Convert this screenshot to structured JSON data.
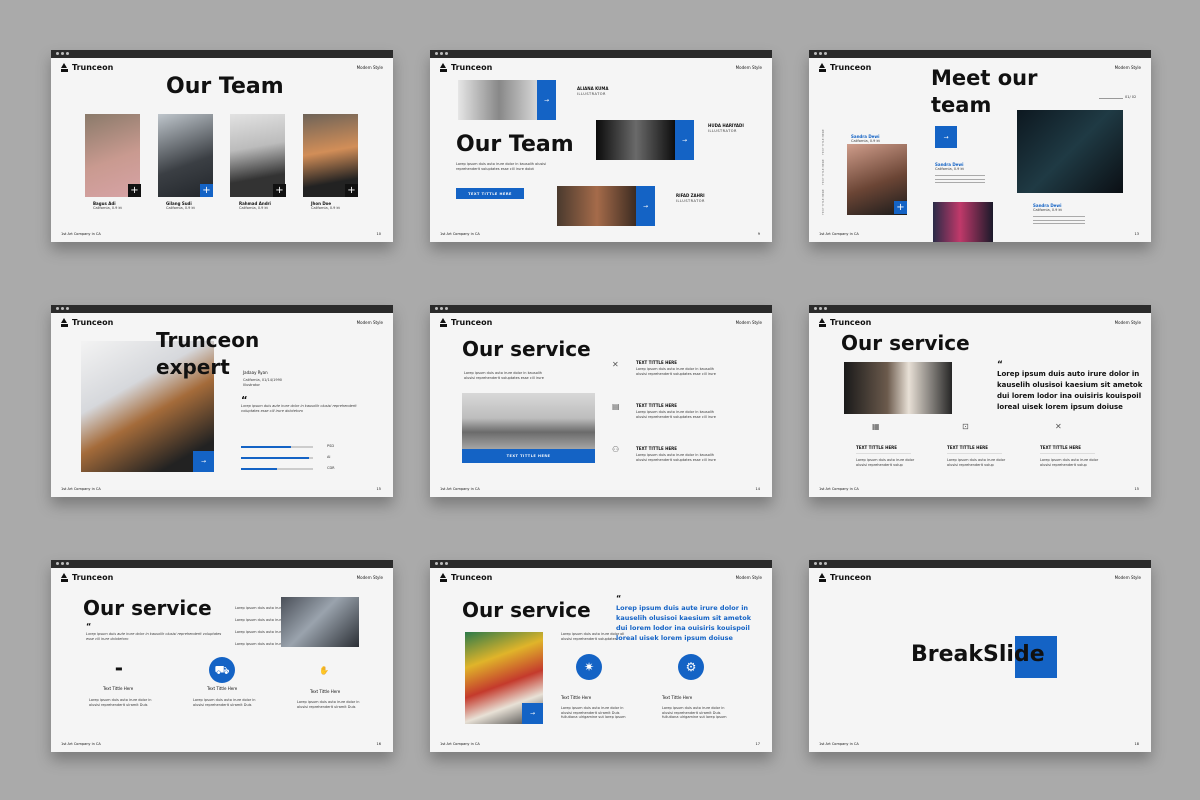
{
  "common": {
    "brand": "Trunceon",
    "tag": "Modern Style",
    "footer": "1st Art Company in CA"
  },
  "slides": {
    "s1": {
      "title": "Our Team",
      "page": "10",
      "members": [
        {
          "name": "Bagus Adi",
          "loc": "California, 0.9 kt"
        },
        {
          "name": "Gilang Sudi",
          "loc": "California, 0.9 kt"
        },
        {
          "name": "Rahmad Andri",
          "loc": "California, 0.9 kt"
        },
        {
          "name": "Jhon Doe",
          "loc": "California, 0.9 kt"
        }
      ]
    },
    "s2": {
      "title": "Our Team",
      "page": "9",
      "button": "TEXT TITTLE HERE",
      "people": [
        {
          "name": "ALIANA KUMA",
          "role": "ILLUSTRATOR"
        },
        {
          "name": "HUDA HARIYADI",
          "role": "ILLUSTRATOR"
        },
        {
          "name": "RIFAD ZAHRI",
          "role": "ILLUSTRATOR"
        }
      ]
    },
    "s3": {
      "title_line1": "Meet our",
      "title_line2": "team",
      "counter": "01/ 02",
      "page": "13",
      "people": [
        {
          "name": "Sandra Dewi",
          "loc": "California, 0.9 kt"
        },
        {
          "name": "Sandra Dewi",
          "loc": "California, 0.9 kt"
        },
        {
          "name": "Sandra Dewi",
          "loc": "California, 0.9 kt"
        }
      ],
      "side_labels": [
        "TEXT TITLE HERE",
        "TEXT TITLE HERE",
        "TEXT TITLE HERE"
      ]
    },
    "s4": {
      "title_line1": "Trunceon",
      "title_line2": "expert",
      "person": "Jadaay Ryan",
      "person_loc": "California, 01/14/1990",
      "person_role": "Illustrator",
      "quote": "Lorep ipsum duis aute irure dolor in kausolih olusisi reprehenderit voluptates esse cill irure dolotetoro",
      "skills": [
        {
          "label": "PSD",
          "value": 0.7
        },
        {
          "label": "AI",
          "value": 0.95
        },
        {
          "label": "CDR",
          "value": 0.5
        }
      ],
      "page": "15"
    },
    "s5": {
      "title": "Our service",
      "button": "TEXT TITTLE HERE",
      "items": [
        "TEXT TITTLE HERE",
        "TEXT TITTLE HERE",
        "TEXT TITTLE HERE"
      ],
      "page": "14"
    },
    "s6": {
      "title": "Our service",
      "quote_mark": "“",
      "quote": [
        "Lorep ipsum duis auto irure dolor in",
        "kauselih olusisoi kaesium sit ametok",
        "dui lorem lodor ina ouisiris kouispoil",
        "loreal uisek lorem ipsum doiuse"
      ],
      "items": [
        "TEXT TITTLE HERE",
        "TEXT TITTLE HERE",
        "TEXT TITTLE HERE"
      ],
      "page": "15"
    },
    "s7": {
      "title": "Our service",
      "quote_mark": "“",
      "quote": "Lorep ipsum duis aute irure dolor in kausolih olusisi reprehenderit voluptates esse cill irure dolotetoro",
      "items": [
        "Text Tittle Here",
        "Text Tittle Here",
        "Text Tittle Here"
      ],
      "page": "16"
    },
    "s8": {
      "title": "Our service",
      "quote_mark": "“",
      "quote": [
        "Lorep ipsum duis aute irure dolor in",
        "kauselih olusisoi kaesium sit ametok",
        "dui lorem lodor ina ouisiris kouispoil",
        "loreal uisek lorem ipsum doiuse"
      ],
      "items": [
        "Text Tittle Here",
        "Text Tittle Here"
      ],
      "page": "17"
    },
    "s9": {
      "title": "BreakSlide",
      "page": "18"
    }
  },
  "colors": {
    "accent": "#1463c5",
    "background": "#aaaaaa",
    "slide": "#f5f5f5"
  }
}
